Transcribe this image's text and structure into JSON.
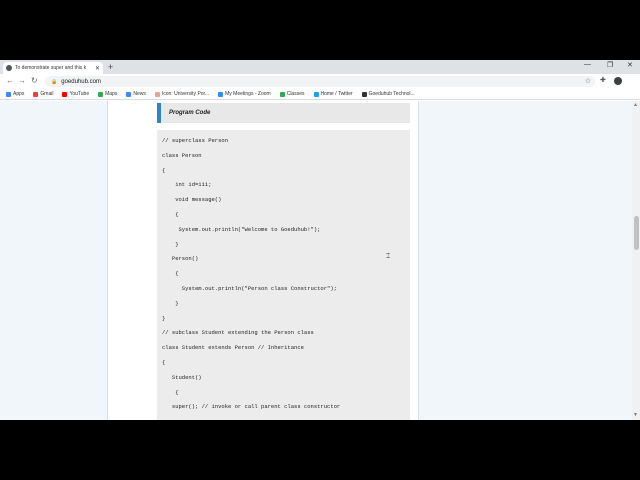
{
  "tab": {
    "title": "To demonstrate super and this k",
    "close": "✕"
  },
  "newtab_label": "+",
  "window": {
    "minimize": "—",
    "restore": "❐",
    "close": "✕"
  },
  "address": {
    "url": "goeduhub.com",
    "lock": "🔒"
  },
  "bookmarks": [
    {
      "label": "Apps",
      "color": "#4285f4"
    },
    {
      "label": "Gmail",
      "color": "#ea4335"
    },
    {
      "label": "YouTube",
      "color": "#ff0000"
    },
    {
      "label": "Maps",
      "color": "#34a853"
    },
    {
      "label": "News",
      "color": "#4285f4"
    },
    {
      "label": "Icon: University Por...",
      "color": "#e8a0a0"
    },
    {
      "label": "My Meetings - Zoom",
      "color": "#2d8cff"
    },
    {
      "label": "Classes",
      "color": "#34a853"
    },
    {
      "label": "Home / Twitter",
      "color": "#1da1f2"
    },
    {
      "label": "Goeduhub Technol...",
      "color": "#333333"
    }
  ],
  "program_header": "Program Code",
  "code": [
    "// superclass Person",
    "class Person",
    "{",
    "    int id=111;",
    "    void message()",
    "    {",
    "     System.out.println(\"Welcome to Goeduhub!\");",
    "    }",
    "   Person()",
    "    {",
    "      System.out.println(\"Person class Constructor\");",
    "    }",
    "}",
    "// subclass Student extending the Person class",
    "class Student extends Person // Inheritance",
    "{",
    "   Student()",
    "    {",
    "   super(); // invoke or call parent class constructor"
  ],
  "colors": {
    "accent": "#2e86c1",
    "code_bg": "#ececec",
    "page_bg": "#f0f6fa"
  }
}
